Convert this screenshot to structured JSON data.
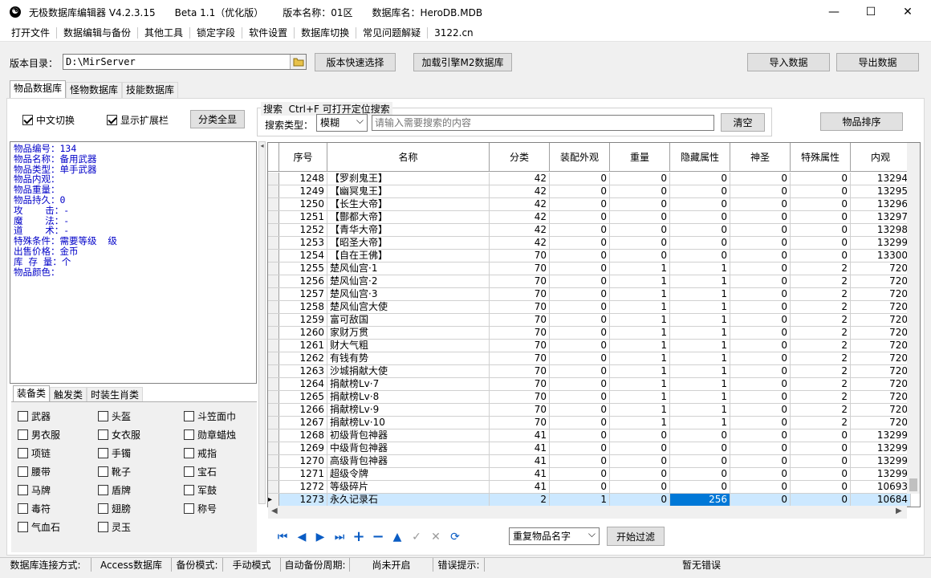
{
  "window": {
    "icon": "yin-yang-icon",
    "title": "无极数据库编辑器 V4.2.3.15",
    "beta": "Beta 1.1（优化版）",
    "version_label": "版本名称：01区",
    "db_label": "数据库名：HeroDB.MDB",
    "minimize": "—",
    "maximize": "☐",
    "close": "✕"
  },
  "menu": [
    "打开文件",
    "数据编辑与备份",
    "其他工具",
    "锁定字段",
    "软件设置",
    "数据库切换",
    "常见问题解疑",
    "3122.cn"
  ],
  "toolbar": {
    "dir_label": "版本目录：",
    "dir_value": "D:\\MirServer",
    "quick_select": "版本快速选择",
    "load_engine": "加载引擎M2数据库",
    "import": "导入数据",
    "export": "导出数据"
  },
  "tabs": [
    "物品数据库",
    "怪物数据库",
    "技能数据库"
  ],
  "options": {
    "chinese_switch": "中文切换",
    "show_ext": "显示扩展栏",
    "show_all": "分类全显"
  },
  "search": {
    "group_title": "搜索  Ctrl+F 可打开定位搜索",
    "type_label": "搜索类型：",
    "type_value": "模糊",
    "placeholder": "请输入需要搜索的内容",
    "clear": "清空",
    "sort": "物品排序"
  },
  "info": [
    "物品编号：134",
    "物品名称：备用武器",
    "物品类型：单手武器",
    "物品内观：",
    "物品重量：",
    "物品持久：0",
    "攻    击：-",
    "魔    法：-",
    "道    术：-",
    "特殊条件：需要等级  级",
    "出售价格：金币",
    "库 存 量：个",
    "物品颜色："
  ],
  "cat_tabs": [
    "装备类",
    "触发类",
    "时装生肖类"
  ],
  "categories": [
    "武器",
    "头盔",
    "斗笠面巾",
    "男衣服",
    "女衣服",
    "勋章蜡烛",
    "项链",
    "手镯",
    "戒指",
    "腰带",
    "靴子",
    "宝石",
    "马牌",
    "盾牌",
    "军鼓",
    "毒符",
    "翅膀",
    "称号",
    "气血石",
    "灵玉"
  ],
  "grid": {
    "headers": [
      "序号",
      "名称",
      "分类",
      "装配外观",
      "重量",
      "隐藏属性",
      "神圣",
      "特殊属性",
      "内观"
    ],
    "rows": [
      [
        "1248",
        "【罗刹鬼王】",
        "42",
        "0",
        "0",
        "0",
        "0",
        "0",
        "13294"
      ],
      [
        "1249",
        "【幽冥鬼王】",
        "42",
        "0",
        "0",
        "0",
        "0",
        "0",
        "13295"
      ],
      [
        "1250",
        "【长生大帝】",
        "42",
        "0",
        "0",
        "0",
        "0",
        "0",
        "13296"
      ],
      [
        "1251",
        "【酆都大帝】",
        "42",
        "0",
        "0",
        "0",
        "0",
        "0",
        "13297"
      ],
      [
        "1252",
        "【青华大帝】",
        "42",
        "0",
        "0",
        "0",
        "0",
        "0",
        "13298"
      ],
      [
        "1253",
        "【昭圣大帝】",
        "42",
        "0",
        "0",
        "0",
        "0",
        "0",
        "13299"
      ],
      [
        "1254",
        "【自在王佛】",
        "70",
        "0",
        "0",
        "0",
        "0",
        "0",
        "13300"
      ],
      [
        "1255",
        "楚风仙宫·1",
        "70",
        "0",
        "1",
        "1",
        "0",
        "2",
        "720"
      ],
      [
        "1256",
        "楚风仙宫·2",
        "70",
        "0",
        "1",
        "1",
        "0",
        "2",
        "720"
      ],
      [
        "1257",
        "楚风仙宫·3",
        "70",
        "0",
        "1",
        "1",
        "0",
        "2",
        "720"
      ],
      [
        "1258",
        "楚风仙宫大使",
        "70",
        "0",
        "1",
        "1",
        "0",
        "2",
        "720"
      ],
      [
        "1259",
        "富可敌国",
        "70",
        "0",
        "1",
        "1",
        "0",
        "2",
        "720"
      ],
      [
        "1260",
        "家财万贯",
        "70",
        "0",
        "1",
        "1",
        "0",
        "2",
        "720"
      ],
      [
        "1261",
        "财大气粗",
        "70",
        "0",
        "1",
        "1",
        "0",
        "2",
        "720"
      ],
      [
        "1262",
        "有钱有势",
        "70",
        "0",
        "1",
        "1",
        "0",
        "2",
        "720"
      ],
      [
        "1263",
        "沙城捐献大使",
        "70",
        "0",
        "1",
        "1",
        "0",
        "2",
        "720"
      ],
      [
        "1264",
        "捐献榜Lv·7",
        "70",
        "0",
        "1",
        "1",
        "0",
        "2",
        "720"
      ],
      [
        "1265",
        "捐献榜Lv·8",
        "70",
        "0",
        "1",
        "1",
        "0",
        "2",
        "720"
      ],
      [
        "1266",
        "捐献榜Lv·9",
        "70",
        "0",
        "1",
        "1",
        "0",
        "2",
        "720"
      ],
      [
        "1267",
        "捐献榜Lv·10",
        "70",
        "0",
        "1",
        "1",
        "0",
        "2",
        "720"
      ],
      [
        "1268",
        "初级背包神器",
        "41",
        "0",
        "0",
        "0",
        "0",
        "0",
        "13299"
      ],
      [
        "1269",
        "中级背包神器",
        "41",
        "0",
        "0",
        "0",
        "0",
        "0",
        "13299"
      ],
      [
        "1270",
        "高级背包神器",
        "41",
        "0",
        "0",
        "0",
        "0",
        "0",
        "13299"
      ],
      [
        "1271",
        "超级令牌",
        "41",
        "0",
        "0",
        "0",
        "0",
        "0",
        "13299"
      ],
      [
        "1272",
        "等级碎片",
        "41",
        "0",
        "0",
        "0",
        "0",
        "0",
        "10693"
      ],
      [
        "1273",
        "永久记录石",
        "2",
        "1",
        "0",
        "256",
        "0",
        "0",
        "10684"
      ]
    ]
  },
  "nav": {
    "first": "⏮",
    "prev": "◀",
    "next": "▶",
    "last": "⏭",
    "add": "+",
    "remove": "−",
    "up": "▲",
    "confirm": "✓",
    "cancel": "✕",
    "refresh": "⟳"
  },
  "filter": {
    "dup_select": "重复物品名字",
    "start": "开始过滤"
  },
  "status": [
    "数据库连接方式:",
    "Access数据库",
    "备份模式:",
    "手动模式",
    "自动备份周期:",
    "尚未开启",
    "错误提示:",
    "暂无错误"
  ]
}
